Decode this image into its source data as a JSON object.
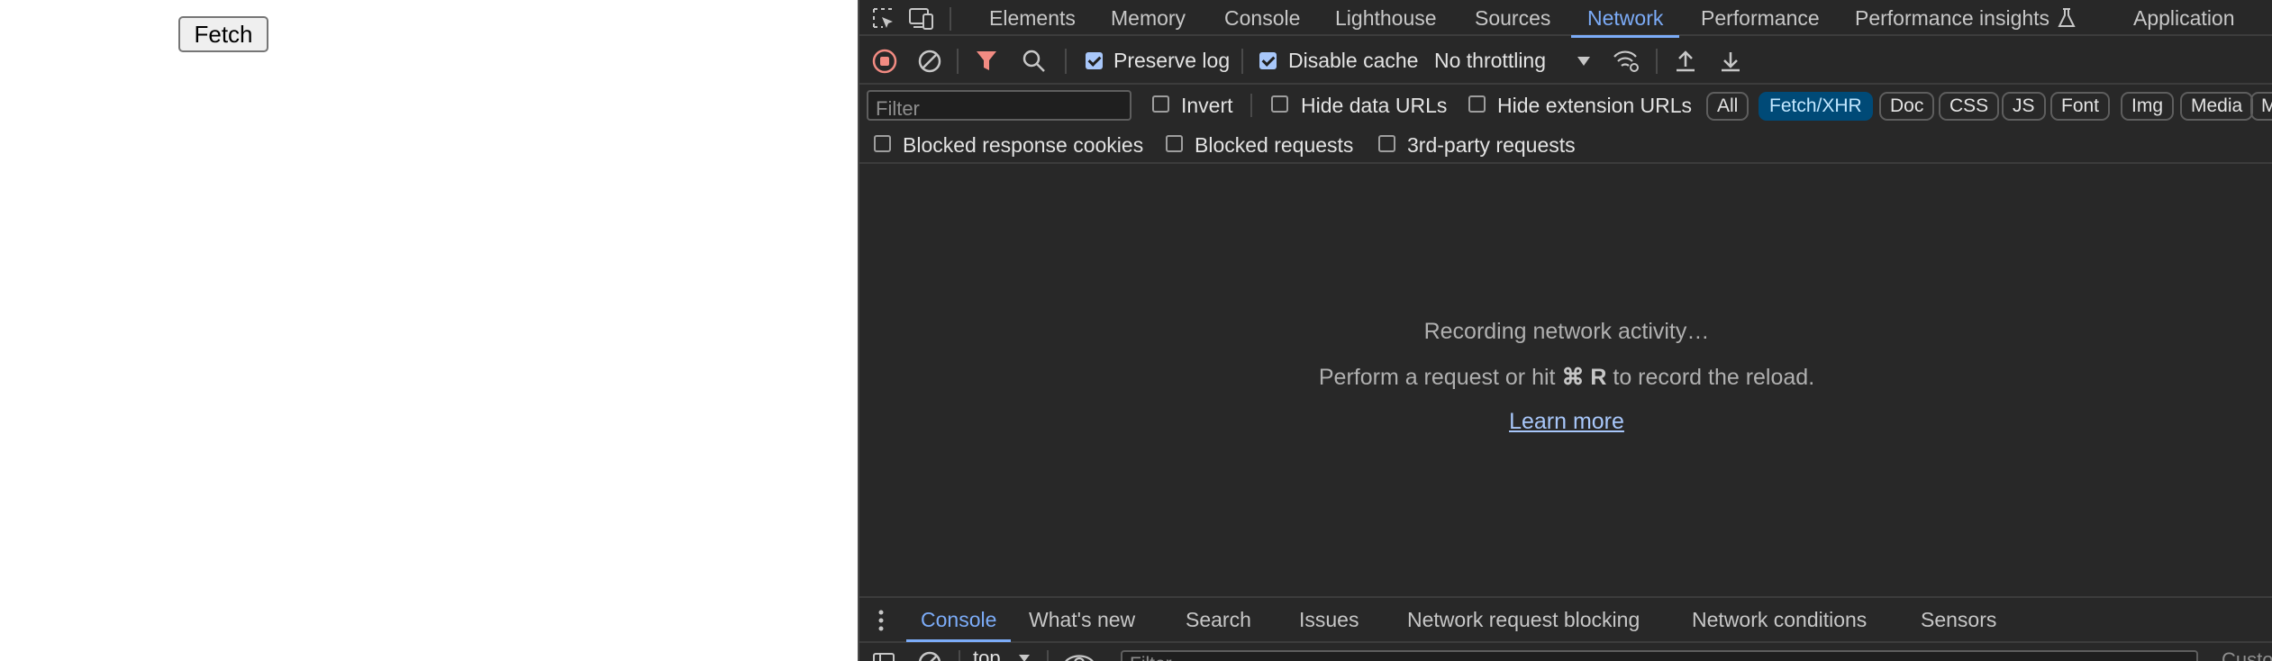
{
  "page": {
    "fetch_button_label": "Fetch"
  },
  "devtools": {
    "main_tabs": [
      {
        "label": "Elements",
        "active": false
      },
      {
        "label": "Memory",
        "active": false
      },
      {
        "label": "Console",
        "active": false
      },
      {
        "label": "Lighthouse",
        "active": false
      },
      {
        "label": "Sources",
        "active": false
      },
      {
        "label": "Network",
        "active": true
      },
      {
        "label": "Performance",
        "active": false
      },
      {
        "label": "Performance insights",
        "active": false
      },
      {
        "label": "Application",
        "active": false
      }
    ],
    "toolbar": {
      "preserve_log_label": "Preserve log",
      "preserve_log_checked": true,
      "disable_cache_label": "Disable cache",
      "disable_cache_checked": true,
      "throttling_value": "No throttling"
    },
    "filter_row": {
      "filter_placeholder": "Filter",
      "invert_label": "Invert",
      "hide_data_urls_label": "Hide data URLs",
      "hide_extension_urls_label": "Hide extension URLs",
      "type_chips": [
        {
          "label": "All",
          "active": false
        },
        {
          "label": "Fetch/XHR",
          "active": true
        },
        {
          "label": "Doc",
          "active": false
        },
        {
          "label": "CSS",
          "active": false
        },
        {
          "label": "JS",
          "active": false
        },
        {
          "label": "Font",
          "active": false
        },
        {
          "label": "Img",
          "active": false
        },
        {
          "label": "Media",
          "active": false
        },
        {
          "label": "M",
          "active": false
        }
      ],
      "blocked_response_cookies_label": "Blocked response cookies",
      "blocked_requests_label": "Blocked requests",
      "third_party_requests_label": "3rd-party requests"
    },
    "empty_state": {
      "title": "Recording network activity…",
      "hint_prefix": "Perform a request or hit",
      "hint_shortcut": "⌘ R",
      "hint_suffix": "to record the reload.",
      "learn_more": "Learn more"
    },
    "drawer": {
      "tabs": [
        {
          "label": "Console",
          "active": true
        },
        {
          "label": "What's new",
          "active": false
        },
        {
          "label": "Search",
          "active": false
        },
        {
          "label": "Issues",
          "active": false
        },
        {
          "label": "Network request blocking",
          "active": false
        },
        {
          "label": "Network conditions",
          "active": false
        },
        {
          "label": "Sensors",
          "active": false
        }
      ],
      "context_value": "top",
      "console_filter_placeholder": "Filter",
      "right_text": "Custo"
    },
    "colors": {
      "accent": "#7cacf8",
      "record_red": "#f28b82",
      "active_chip_bg": "#004a77"
    }
  }
}
